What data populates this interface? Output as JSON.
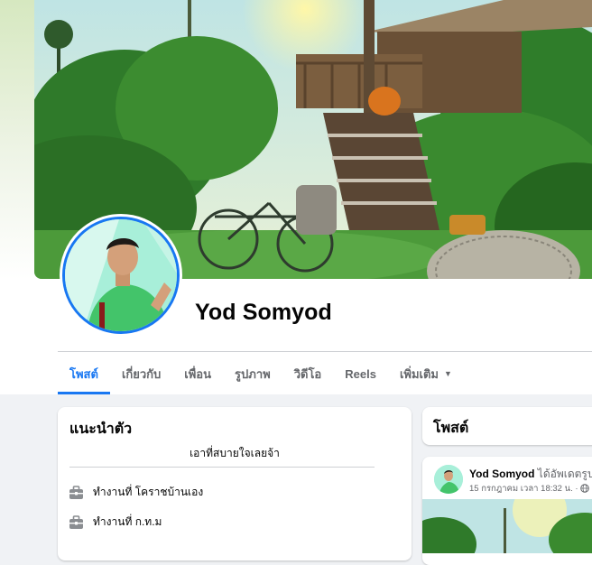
{
  "profile": {
    "name": "Yod Somyod"
  },
  "tabs": [
    {
      "label": "โพสต์",
      "active": true
    },
    {
      "label": "เกี่ยวกับ"
    },
    {
      "label": "เพื่อน"
    },
    {
      "label": "รูปภาพ"
    },
    {
      "label": "วิดีโอ"
    },
    {
      "label": "Reels"
    },
    {
      "label": "เพิ่มเติม"
    }
  ],
  "intro": {
    "title": "แนะนำตัว",
    "bio": "เอาที่สบายใจเลยจ้า",
    "items": [
      {
        "icon": "briefcase-icon",
        "text": "ทำงานที่ โคราชบ้านเอง"
      },
      {
        "icon": "briefcase-icon",
        "text": "ทำงานที่ ก.ท.ม"
      }
    ]
  },
  "posts_header": {
    "title": "โพสต์"
  },
  "post": {
    "author": "Yod Somyod",
    "action": " ได้อัพเดตรูปโ",
    "timestamp": "15 กรกฎาคม เวลา 18:32 น. ·",
    "privacy_icon": "globe-icon"
  },
  "colors": {
    "accent": "#1877f2",
    "secondary_text": "#65676b",
    "page_background": "#f0f2f5"
  }
}
